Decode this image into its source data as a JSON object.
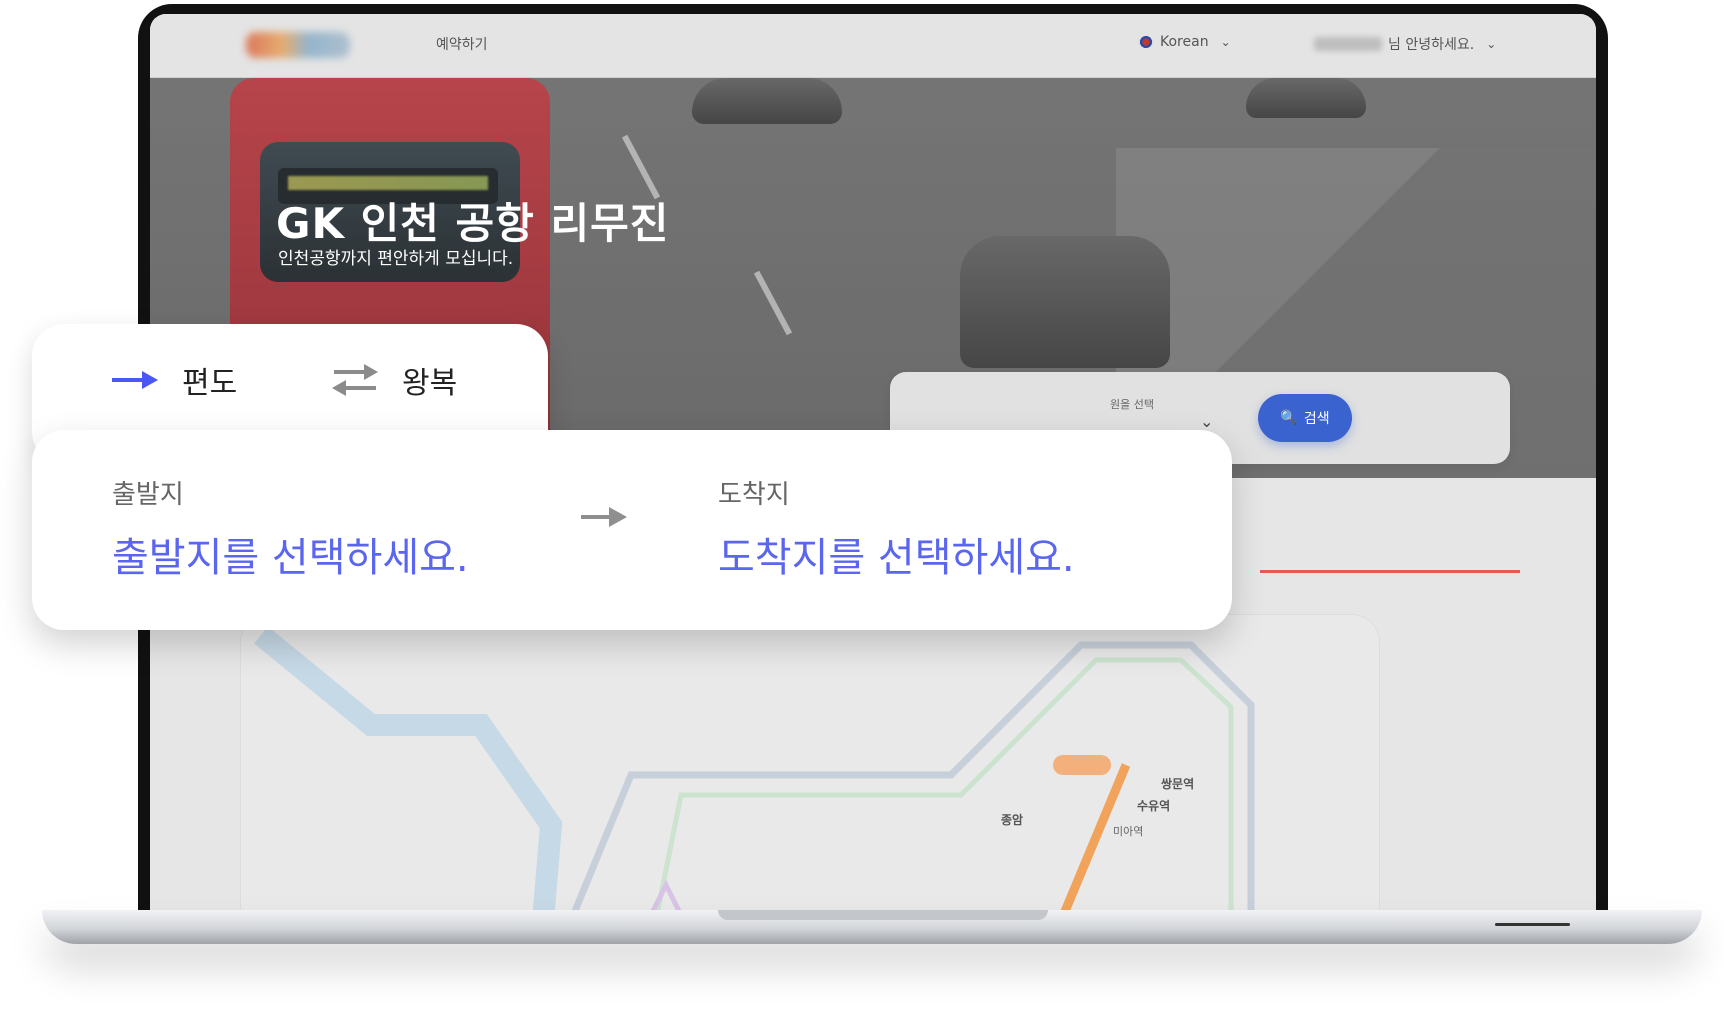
{
  "nav": {
    "book_link": "예약하기",
    "language": "Korean",
    "user_greeting": "님 안녕하세요."
  },
  "hero": {
    "title": "GK 인천 공항 리무진",
    "subtitle": "인천공항까지 편안하게 모십니다."
  },
  "search": {
    "button_label": "검색",
    "field_hint": "원을 선택"
  },
  "trip_tabs": {
    "oneway": "편도",
    "roundtrip": "왕복"
  },
  "route": {
    "origin_label": "출발지",
    "origin_placeholder": "출발지를 선택하세요.",
    "destination_label": "도착지",
    "destination_placeholder": "도착지를 선택하세요."
  },
  "map": {
    "stations": [
      "쌍문역",
      "수유역",
      "미아역",
      "종암"
    ]
  },
  "colors": {
    "accent_blue": "#5b66ee",
    "search_button": "#3a63cf",
    "divider_red": "#e45a5a"
  }
}
